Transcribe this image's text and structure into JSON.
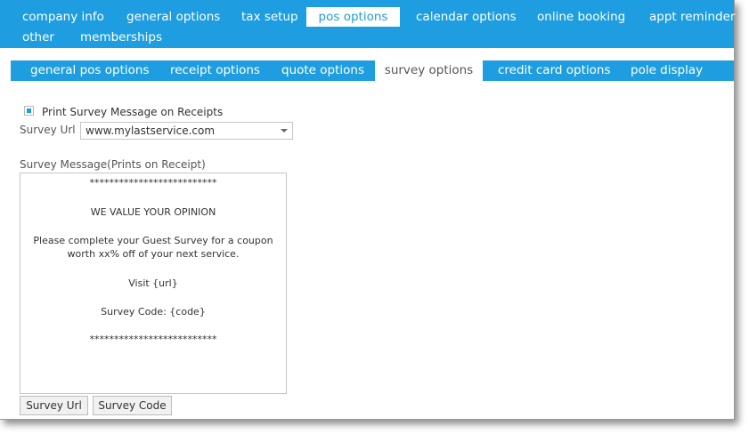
{
  "top_tabs": [
    {
      "label": "company info"
    },
    {
      "label": "general options"
    },
    {
      "label": "tax setup"
    },
    {
      "label": "pos options"
    },
    {
      "label": "calendar options"
    },
    {
      "label": "online booking"
    },
    {
      "label": "appt reminder"
    },
    {
      "label": "other"
    },
    {
      "label": "memberships"
    }
  ],
  "sub_tabs": [
    {
      "label": "general pos options"
    },
    {
      "label": "receipt options"
    },
    {
      "label": "quote options"
    },
    {
      "label": "survey options"
    },
    {
      "label": "credit card options"
    },
    {
      "label": "pole display"
    }
  ],
  "survey": {
    "print_checkbox_label": "Print Survey Message on Receipts",
    "print_checked": true,
    "url_label": "Survey Url",
    "url_value": "www.mylastservice.com",
    "message_label": "Survey Message(Prints on Receipt)",
    "message_lines": [
      "**************************",
      "WE VALUE YOUR OPINION",
      "Please complete your Guest Survey for a coupon",
      "worth xx% off of your next service.",
      "Visit {url}",
      "Survey Code: {code}",
      "**************************"
    ],
    "btn_url": "Survey Url",
    "btn_code": "Survey Code"
  },
  "colors": {
    "accent": "#1e9ee0"
  }
}
